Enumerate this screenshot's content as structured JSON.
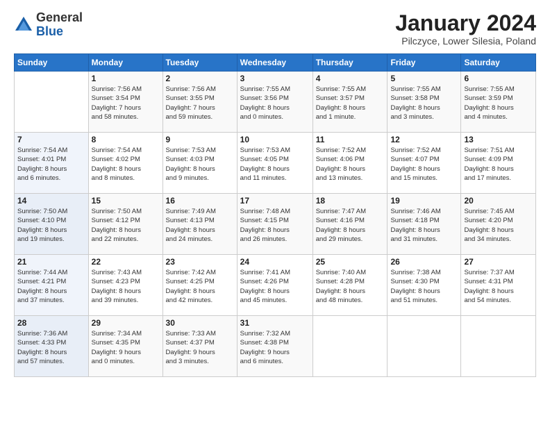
{
  "logo": {
    "general": "General",
    "blue": "Blue"
  },
  "header": {
    "title": "January 2024",
    "subtitle": "Pilczyce, Lower Silesia, Poland"
  },
  "weekdays": [
    "Sunday",
    "Monday",
    "Tuesday",
    "Wednesday",
    "Thursday",
    "Friday",
    "Saturday"
  ],
  "weeks": [
    [
      {
        "day": "",
        "info": ""
      },
      {
        "day": "1",
        "info": "Sunrise: 7:56 AM\nSunset: 3:54 PM\nDaylight: 7 hours\nand 58 minutes."
      },
      {
        "day": "2",
        "info": "Sunrise: 7:56 AM\nSunset: 3:55 PM\nDaylight: 7 hours\nand 59 minutes."
      },
      {
        "day": "3",
        "info": "Sunrise: 7:55 AM\nSunset: 3:56 PM\nDaylight: 8 hours\nand 0 minutes."
      },
      {
        "day": "4",
        "info": "Sunrise: 7:55 AM\nSunset: 3:57 PM\nDaylight: 8 hours\nand 1 minute."
      },
      {
        "day": "5",
        "info": "Sunrise: 7:55 AM\nSunset: 3:58 PM\nDaylight: 8 hours\nand 3 minutes."
      },
      {
        "day": "6",
        "info": "Sunrise: 7:55 AM\nSunset: 3:59 PM\nDaylight: 8 hours\nand 4 minutes."
      }
    ],
    [
      {
        "day": "7",
        "info": "Sunrise: 7:54 AM\nSunset: 4:01 PM\nDaylight: 8 hours\nand 6 minutes."
      },
      {
        "day": "8",
        "info": "Sunrise: 7:54 AM\nSunset: 4:02 PM\nDaylight: 8 hours\nand 8 minutes."
      },
      {
        "day": "9",
        "info": "Sunrise: 7:53 AM\nSunset: 4:03 PM\nDaylight: 8 hours\nand 9 minutes."
      },
      {
        "day": "10",
        "info": "Sunrise: 7:53 AM\nSunset: 4:05 PM\nDaylight: 8 hours\nand 11 minutes."
      },
      {
        "day": "11",
        "info": "Sunrise: 7:52 AM\nSunset: 4:06 PM\nDaylight: 8 hours\nand 13 minutes."
      },
      {
        "day": "12",
        "info": "Sunrise: 7:52 AM\nSunset: 4:07 PM\nDaylight: 8 hours\nand 15 minutes."
      },
      {
        "day": "13",
        "info": "Sunrise: 7:51 AM\nSunset: 4:09 PM\nDaylight: 8 hours\nand 17 minutes."
      }
    ],
    [
      {
        "day": "14",
        "info": "Sunrise: 7:50 AM\nSunset: 4:10 PM\nDaylight: 8 hours\nand 19 minutes."
      },
      {
        "day": "15",
        "info": "Sunrise: 7:50 AM\nSunset: 4:12 PM\nDaylight: 8 hours\nand 22 minutes."
      },
      {
        "day": "16",
        "info": "Sunrise: 7:49 AM\nSunset: 4:13 PM\nDaylight: 8 hours\nand 24 minutes."
      },
      {
        "day": "17",
        "info": "Sunrise: 7:48 AM\nSunset: 4:15 PM\nDaylight: 8 hours\nand 26 minutes."
      },
      {
        "day": "18",
        "info": "Sunrise: 7:47 AM\nSunset: 4:16 PM\nDaylight: 8 hours\nand 29 minutes."
      },
      {
        "day": "19",
        "info": "Sunrise: 7:46 AM\nSunset: 4:18 PM\nDaylight: 8 hours\nand 31 minutes."
      },
      {
        "day": "20",
        "info": "Sunrise: 7:45 AM\nSunset: 4:20 PM\nDaylight: 8 hours\nand 34 minutes."
      }
    ],
    [
      {
        "day": "21",
        "info": "Sunrise: 7:44 AM\nSunset: 4:21 PM\nDaylight: 8 hours\nand 37 minutes."
      },
      {
        "day": "22",
        "info": "Sunrise: 7:43 AM\nSunset: 4:23 PM\nDaylight: 8 hours\nand 39 minutes."
      },
      {
        "day": "23",
        "info": "Sunrise: 7:42 AM\nSunset: 4:25 PM\nDaylight: 8 hours\nand 42 minutes."
      },
      {
        "day": "24",
        "info": "Sunrise: 7:41 AM\nSunset: 4:26 PM\nDaylight: 8 hours\nand 45 minutes."
      },
      {
        "day": "25",
        "info": "Sunrise: 7:40 AM\nSunset: 4:28 PM\nDaylight: 8 hours\nand 48 minutes."
      },
      {
        "day": "26",
        "info": "Sunrise: 7:38 AM\nSunset: 4:30 PM\nDaylight: 8 hours\nand 51 minutes."
      },
      {
        "day": "27",
        "info": "Sunrise: 7:37 AM\nSunset: 4:31 PM\nDaylight: 8 hours\nand 54 minutes."
      }
    ],
    [
      {
        "day": "28",
        "info": "Sunrise: 7:36 AM\nSunset: 4:33 PM\nDaylight: 8 hours\nand 57 minutes."
      },
      {
        "day": "29",
        "info": "Sunrise: 7:34 AM\nSunset: 4:35 PM\nDaylight: 9 hours\nand 0 minutes."
      },
      {
        "day": "30",
        "info": "Sunrise: 7:33 AM\nSunset: 4:37 PM\nDaylight: 9 hours\nand 3 minutes."
      },
      {
        "day": "31",
        "info": "Sunrise: 7:32 AM\nSunset: 4:38 PM\nDaylight: 9 hours\nand 6 minutes."
      },
      {
        "day": "",
        "info": ""
      },
      {
        "day": "",
        "info": ""
      },
      {
        "day": "",
        "info": ""
      }
    ]
  ]
}
